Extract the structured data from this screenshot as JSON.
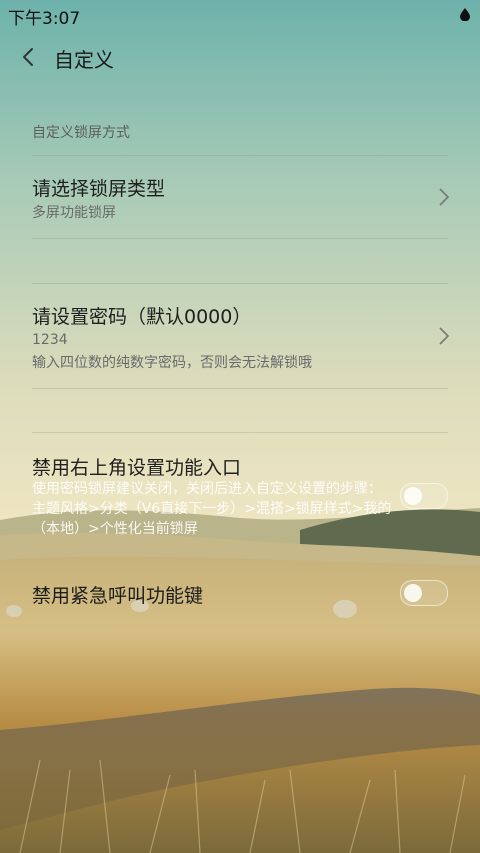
{
  "status_bar": {
    "time": "下午3:07"
  },
  "header": {
    "title": "自定义"
  },
  "section": {
    "title": "自定义锁屏方式"
  },
  "lock_type": {
    "title": "请选择锁屏类型",
    "value": "多屏功能锁屏"
  },
  "password": {
    "title": "请设置密码（默认0000）",
    "value": "1234",
    "hint": "输入四位数的纯数字密码，否则会无法解锁哦"
  },
  "disable_settings_entry": {
    "title": "禁用右上角设置功能入口",
    "description": "使用密码锁屏建议关闭，关闭后进入自定义设置的步骤：主题风格>分类（V6直接下一步）>混搭>锁屏样式>我的（本地）>个性化当前锁屏",
    "enabled": false
  },
  "disable_emergency_call": {
    "title": "禁用紧急呼叫功能键",
    "enabled": false
  },
  "icons": {
    "back": "back-arrow-icon",
    "chevron": "chevron-right-icon",
    "status_drop": "drop-icon"
  },
  "colors": {
    "sky_top": "#6fb3ac",
    "sky_bottom": "#e9e3bd",
    "field": "#c9a45a"
  }
}
